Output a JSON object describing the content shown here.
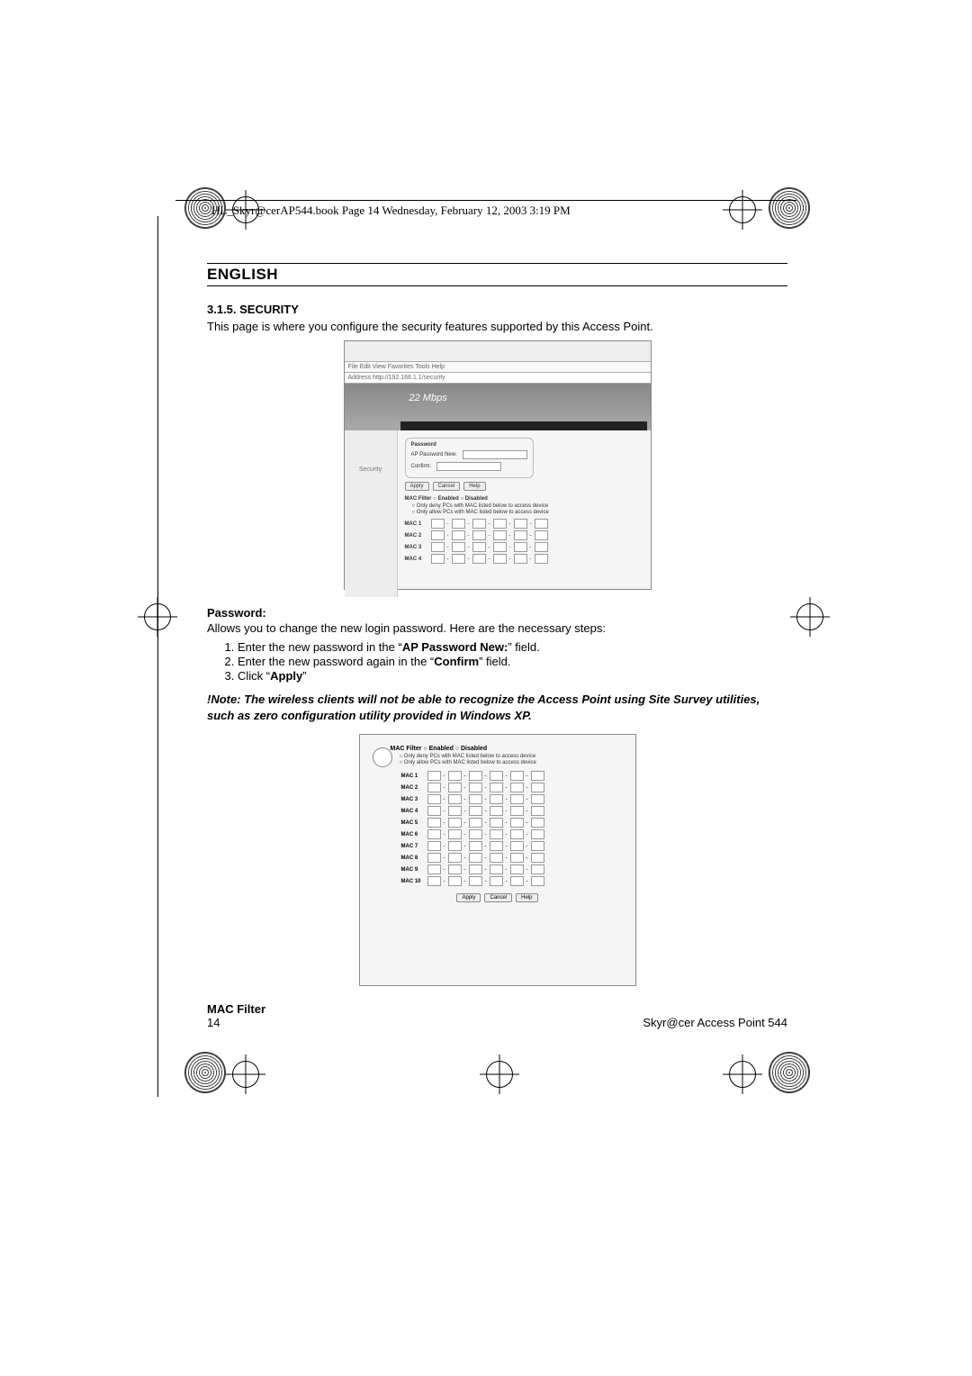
{
  "header": "HL_Skyr@cerAP544.book  Page 14  Wednesday, February 12, 2003  3:19 PM",
  "lang_heading": "ENGLISH",
  "section_heading": "3.1.5. SECURITY",
  "intro": "This page is where you configure the security features supported by this Access Point.",
  "fig1": {
    "menu": "File   Edit   View   Favorites   Tools   Help",
    "address": "Address   http://192.168.1.1/security",
    "banner_title": "22 Mbps",
    "side_label": "Security",
    "password_group_label": "Password",
    "new_label": "AP Password New:",
    "confirm_label": "Confirm:",
    "btn_apply": "Apply",
    "btn_cancel": "Cancel",
    "btn_help": "Help",
    "macfilter_title": "MAC Filter   ○ Enabled  ○ Disabled",
    "deny_line": "○  Only deny PCs with MAC listed below to access device",
    "allow_line": "○  Only allow PCs with MAC listed below to access device",
    "mac_labels": [
      "MAC 1",
      "MAC 2",
      "MAC 3",
      "MAC 4"
    ]
  },
  "password_section_title": "Password:",
  "password_section_text": "Allows you to change the new login password. Here are the necessary steps:",
  "steps": [
    "Enter the new password in the “AP Password New:” field.",
    "Enter the new password again in the “Confirm” field.",
    "Click “Apply”"
  ],
  "step_markers": {
    "ap_pw": "AP Password New:",
    "confirm": "Confirm",
    "apply": "Apply"
  },
  "note": "!Note: The wireless clients will not be able to recognize the Access Point using Site Survey utilities, such as zero configuration utility provided in Windows XP.",
  "fig2": {
    "hdr": "MAC Filter   ○ Enabled  ○ Disabled",
    "deny_line": "○  Only deny PCs with MAC listed below to access device",
    "allow_line": "○  Only allow PCs with MAC listed below to access device",
    "mac_labels": [
      "MAC 1",
      "MAC 2",
      "MAC 3",
      "MAC 4",
      "MAC 5",
      "MAC 6",
      "MAC 7",
      "MAC 8",
      "MAC 9",
      "MAC 10"
    ],
    "btn_apply": "Apply",
    "btn_cancel": "Cancel",
    "btn_help": "Help"
  },
  "mac_filter_heading": "MAC Filter",
  "footer": {
    "page": "14",
    "product": "Skyr@cer Access Point 544"
  }
}
